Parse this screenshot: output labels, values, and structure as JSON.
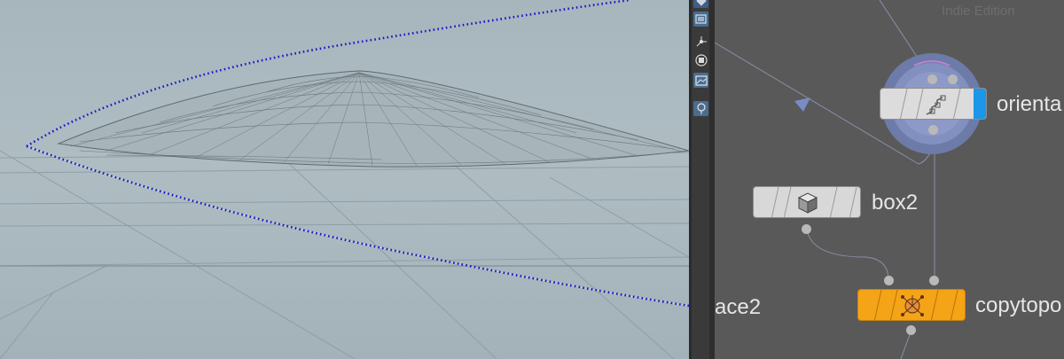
{
  "network": {
    "watermark": "Indie Edition",
    "nodes": [
      {
        "id": "orient",
        "label": "orienta",
        "type": "orientalongcurve",
        "display_flag_color": "#1c96e8",
        "selected": true
      },
      {
        "id": "box2",
        "label": "box2",
        "type": "box"
      },
      {
        "id": "copy",
        "label": "copytopo",
        "type": "copytopoints",
        "color": "#f5a317"
      },
      {
        "id": "resample",
        "label": "ace2",
        "type": "partial-offscreen"
      }
    ]
  },
  "toolstrip": {
    "tools": [
      "display-options-icon",
      "view-icon",
      "snap-icon",
      "display-mode-icon",
      "background-icon",
      "light-icon"
    ]
  },
  "colors": {
    "viewport_bg": "#a9b8be",
    "curve_points": "#1a1acc",
    "network_bg": "#595959",
    "node_body": "#d8d8d8",
    "copy_node": "#f5a317"
  }
}
